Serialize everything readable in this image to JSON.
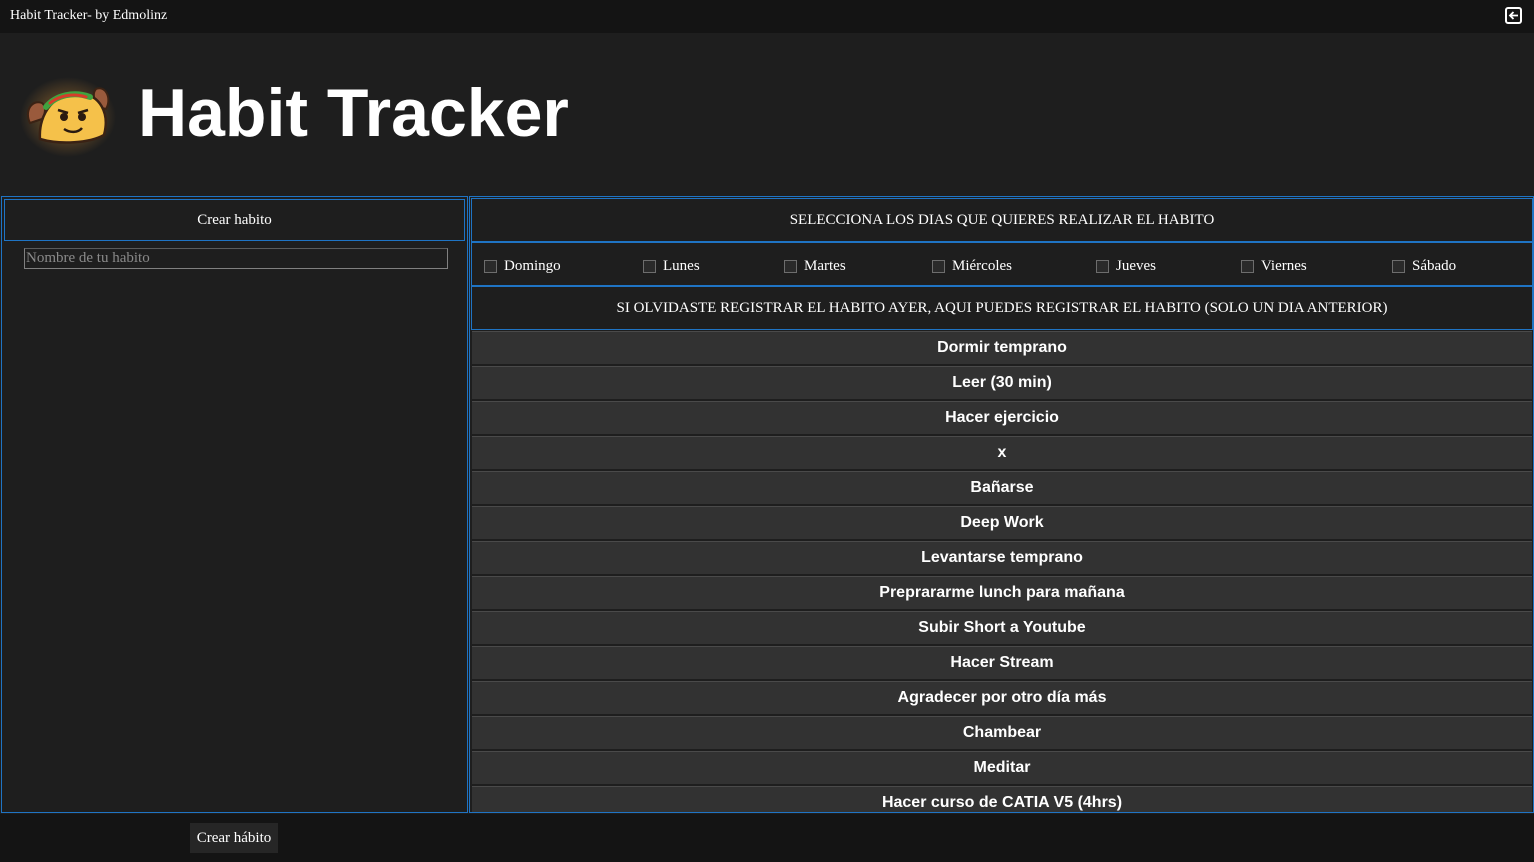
{
  "window": {
    "title": "Habit Tracker- by Edmolinz",
    "exit_icon": "exit-icon"
  },
  "header": {
    "logo_icon": "taco-mascot-logo",
    "title": "Habit Tracker"
  },
  "left_panel": {
    "header": "Crear habito",
    "name_input": {
      "value": "",
      "placeholder": "Nombre de tu habito"
    }
  },
  "right_panel": {
    "days_header": "SELECCIONA LOS DIAS QUE QUIERES REALIZAR EL HABITO",
    "days": [
      {
        "label": "Domingo",
        "checked": false
      },
      {
        "label": "Lunes",
        "checked": false
      },
      {
        "label": "Martes",
        "checked": false
      },
      {
        "label": "Miércoles",
        "checked": false
      },
      {
        "label": "Jueves",
        "checked": false
      },
      {
        "label": "Viernes",
        "checked": false
      },
      {
        "label": "Sábado",
        "checked": false
      }
    ],
    "forgot_header": "SI OLVIDASTE REGISTRAR EL HABITO AYER, AQUI PUEDES REGISTRAR EL HABITO (SOLO UN DIA ANTERIOR)",
    "habits": [
      "Dormir temprano",
      "Leer (30 min)",
      "Hacer ejercicio",
      "x",
      "Bañarse",
      "Deep Work",
      "Levantarse temprano",
      "Preprararme lunch para mañana",
      "Subir Short a Youtube",
      "Hacer Stream",
      "Agradecer por otro día más",
      "Chambear",
      "Meditar",
      "Hacer curso de CATIA V5 (4hrs)"
    ]
  },
  "footer": {
    "create_button": "Crear hábito"
  },
  "colors": {
    "background": "#1e1e1e",
    "titlebar": "#141414",
    "accent_border": "#1f74c4",
    "habit_button": "#323232"
  }
}
